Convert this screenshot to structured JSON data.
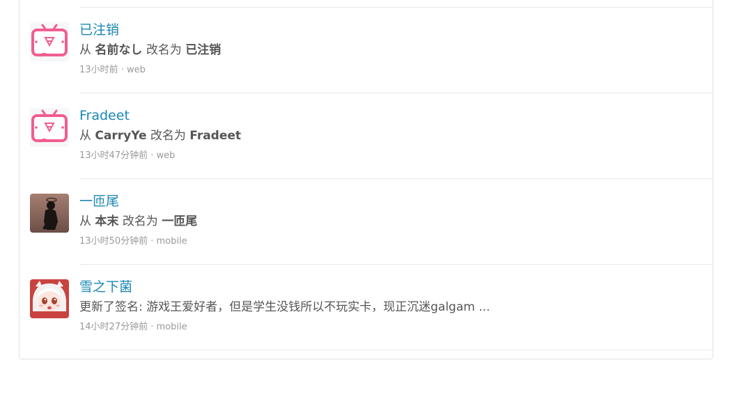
{
  "entries": [
    {
      "avatar_icon": "bilibili-tv-avatar-icon",
      "name": "已注销",
      "action_prefix": "从",
      "old_name": "名前なし",
      "action_middle": "改名为",
      "new_name": "已注销",
      "time": "13小时前",
      "separator": "·",
      "source": "web"
    },
    {
      "avatar_icon": "bilibili-tv-avatar-icon",
      "name": "Fradeet",
      "action_prefix": "从",
      "old_name": "CarryYe",
      "action_middle": "改名为",
      "new_name": "Fradeet",
      "time": "13小时47分钟前",
      "separator": "·",
      "source": "web"
    },
    {
      "avatar_icon": "silhouette-avatar-icon",
      "name": "一匝尾",
      "action_prefix": "从",
      "old_name": "本末",
      "action_middle": "改名为",
      "new_name": "一匝尾",
      "time": "13小时50分钟前",
      "separator": "·",
      "source": "mobile"
    },
    {
      "avatar_icon": "anime-girl-avatar-icon",
      "name": "雪之下菌",
      "action_text": "更新了签名: 游戏王爱好者，但是学生没钱所以不玩实卡，现正沉迷galgam ...",
      "time": "14小时27分钟前",
      "separator": "·",
      "source": "mobile"
    }
  ],
  "colors": {
    "link": "#1a87b5",
    "text": "#555555",
    "meta": "#999999",
    "bilibili_pink": "#f25d8e"
  }
}
